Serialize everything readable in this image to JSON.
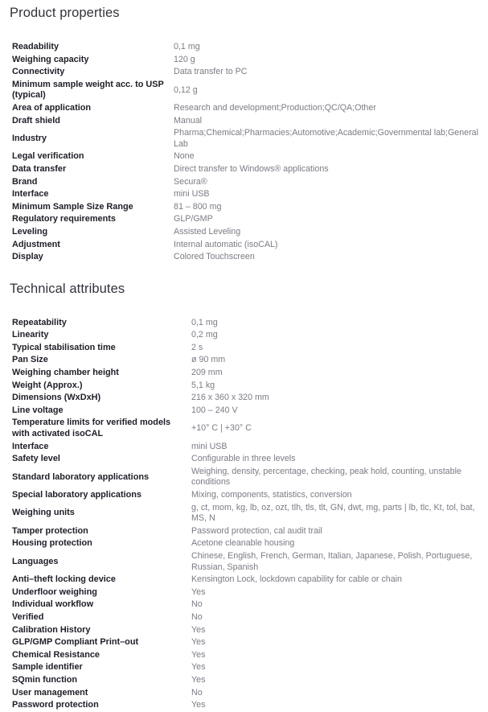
{
  "document": {
    "sections": [
      {
        "id": "product-properties",
        "heading": "Product properties",
        "rows": [
          {
            "label": "Readability",
            "value": "0,1 mg"
          },
          {
            "label": "Weighing capacity",
            "value": "120 g"
          },
          {
            "label": "Connectivity",
            "value": "Data transfer to PC"
          },
          {
            "label": "Minimum sample weight acc. to USP (typical)",
            "value": "0,12 g"
          },
          {
            "label": "Area of application",
            "value": "Research and development;Production;QC/QA;Other"
          },
          {
            "label": "Draft shield",
            "value": "Manual"
          },
          {
            "label": "Industry",
            "value": "Pharma;Chemical;Pharmacies;Automotive;Academic;Governmental lab;General Lab"
          },
          {
            "label": "Legal verification",
            "value": "None"
          },
          {
            "label": "Data transfer",
            "value": "Direct transfer to Windows® applications"
          },
          {
            "label": "Brand",
            "value": "Secura®"
          },
          {
            "label": "Interface",
            "value": "mini USB"
          },
          {
            "label": "Minimum Sample Size Range",
            "value": "81 – 800 mg"
          },
          {
            "label": "Regulatory requirements",
            "value": "GLP/GMP"
          },
          {
            "label": "Leveling",
            "value": "Assisted Leveling"
          },
          {
            "label": "Adjustment",
            "value": "Internal automatic (isoCAL)"
          },
          {
            "label": "Display",
            "value": "Colored Touchscreen"
          }
        ]
      },
      {
        "id": "technical-attributes",
        "heading": "Technical attributes",
        "rows": [
          {
            "label": "Repeatability",
            "value": "0,1 mg"
          },
          {
            "label": "Linearity",
            "value": "0,2 mg"
          },
          {
            "label": "Typical stabilisation time",
            "value": "2 s"
          },
          {
            "label": "Pan Size",
            "value": "ø 90 mm"
          },
          {
            "label": "Weighing chamber height",
            "value": "209 mm"
          },
          {
            "label": "Weight (Approx.)",
            "value": "5,1 kg"
          },
          {
            "label": "Dimensions (WxDxH)",
            "value": "216 x 360 x 320 mm"
          },
          {
            "label": "Line voltage",
            "value": "100 – 240 V"
          },
          {
            "label": "Temperature limits for verified models with activated isoCAL",
            "value": "+10° C | +30° C"
          },
          {
            "label": "Interface",
            "value": "mini USB"
          },
          {
            "label": "Safety level",
            "value": "Configurable in three levels"
          },
          {
            "label": "Standard laboratory applications",
            "value": "Weighing, density, percentage, checking, peak hold, counting, unstable conditions"
          },
          {
            "label": "Special laboratory applications",
            "value": "Mixing, components, statistics, conversion"
          },
          {
            "label": "Weighing units",
            "value": "g, ct, mom, kg, lb, oz, ozt, tlh, tls, tlt, GN, dwt, mg, parts | lb, tlc, Kt, tol, bat, MS, N"
          },
          {
            "label": "Tamper protection",
            "value": "Password protection, cal audit trail"
          },
          {
            "label": "Housing protection",
            "value": "Acetone cleanable housing"
          },
          {
            "label": "Languages",
            "value": "Chinese, English, French, German, Italian, Japanese, Polish, Portuguese, Russian, Spanish"
          },
          {
            "label": "Anti–theft locking device",
            "value": "Kensington Lock, lockdown capability for cable or chain"
          },
          {
            "label": "Underfloor weighing",
            "value": "Yes"
          },
          {
            "label": "Individual workflow",
            "value": "No"
          },
          {
            "label": "Verified",
            "value": "No"
          },
          {
            "label": "Calibration History",
            "value": "Yes"
          },
          {
            "label": "GLP/GMP Compliant Print–out",
            "value": "Yes"
          },
          {
            "label": "Chemical Resistance",
            "value": "Yes"
          },
          {
            "label": "Sample identifier",
            "value": "Yes"
          },
          {
            "label": "SQmin function",
            "value": "Yes"
          },
          {
            "label": "User management",
            "value": "No"
          },
          {
            "label": "Password protection",
            "value": "Yes"
          }
        ]
      }
    ]
  },
  "theme": {
    "heading_color": "#32323c",
    "label_color": "#1e1e28",
    "value_color": "#7b7b85",
    "background": "#ffffff"
  }
}
